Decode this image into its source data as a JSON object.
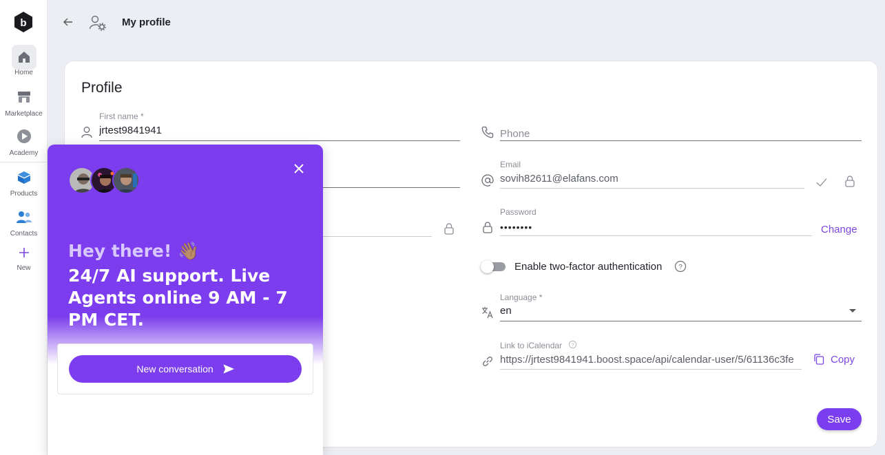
{
  "sidebar": {
    "items": [
      {
        "label": "Home",
        "icon": "home-icon"
      },
      {
        "label": "Marketplace",
        "icon": "store-icon"
      },
      {
        "label": "Academy",
        "icon": "play-icon"
      },
      {
        "label": "Products",
        "icon": "box-icon"
      },
      {
        "label": "Contacts",
        "icon": "people-icon"
      },
      {
        "label": "New",
        "icon": "plus-icon"
      }
    ]
  },
  "header": {
    "title": "My profile"
  },
  "profile": {
    "title": "Profile",
    "first_name": {
      "label": "First name *",
      "value": "jrtest9841941"
    },
    "phone": {
      "placeholder": "Phone"
    },
    "email": {
      "label": "Email",
      "value": "sovih82611@elafans.com"
    },
    "password": {
      "label": "Password",
      "value": "••••••••",
      "change_label": "Change"
    },
    "two_factor": {
      "label": "Enable two-factor authentication",
      "enabled": false
    },
    "language": {
      "label": "Language *",
      "value": "en"
    },
    "icalendar": {
      "label": "Link to iCalendar",
      "value": "https://jrtest9841941.boost.space/api/calendar-user/5/61136c3fe",
      "copy_label": "Copy"
    },
    "save_label": "Save"
  },
  "chat": {
    "greeting": "Hey there! 👋🏽",
    "tagline": "24/7 AI support. Live Agents online 9 AM - 7 PM CET.",
    "button_label": "New conversation"
  },
  "colors": {
    "accent": "#7b3df0",
    "chat_bg": "#7b3ded"
  }
}
